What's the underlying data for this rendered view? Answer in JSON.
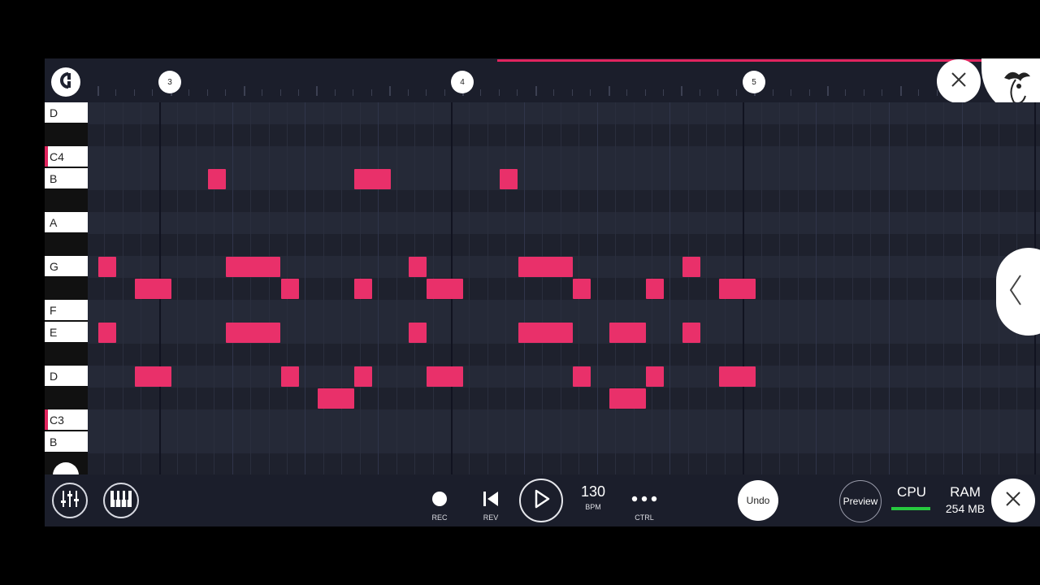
{
  "timeline": {
    "bar_markers": [
      "3",
      "4",
      "5"
    ]
  },
  "keyboard": {
    "keys": [
      {
        "label": "D",
        "c": false
      },
      {
        "label": "C4",
        "c": true
      },
      {
        "label": "B",
        "c": false
      },
      {
        "label": "A",
        "c": false
      },
      {
        "label": "G",
        "c": false
      },
      {
        "label": "F",
        "c": false
      },
      {
        "label": "E",
        "c": false
      },
      {
        "label": "D",
        "c": false
      },
      {
        "label": "C3",
        "c": true
      },
      {
        "label": "B",
        "c": false
      }
    ]
  },
  "piano_roll": {
    "note_color": "#e9306a",
    "notes": [
      {
        "row": 3,
        "start": 22,
        "len": 1
      },
      {
        "row": 3,
        "start": 30,
        "len": 2
      },
      {
        "row": 3,
        "start": 38,
        "len": 1
      },
      {
        "row": 7,
        "start": 16,
        "len": 1
      },
      {
        "row": 7,
        "start": 23,
        "len": 3
      },
      {
        "row": 7,
        "start": 33,
        "len": 1
      },
      {
        "row": 7,
        "start": 39,
        "len": 3
      },
      {
        "row": 7,
        "start": 48,
        "len": 1
      },
      {
        "row": 8,
        "start": 18,
        "len": 2
      },
      {
        "row": 8,
        "start": 26,
        "len": 1
      },
      {
        "row": 8,
        "start": 30,
        "len": 1
      },
      {
        "row": 8,
        "start": 34,
        "len": 2
      },
      {
        "row": 8,
        "start": 42,
        "len": 1
      },
      {
        "row": 8,
        "start": 46,
        "len": 1
      },
      {
        "row": 8,
        "start": 50,
        "len": 2
      },
      {
        "row": 10,
        "start": 16,
        "len": 1
      },
      {
        "row": 10,
        "start": 23,
        "len": 3
      },
      {
        "row": 10,
        "start": 33,
        "len": 1
      },
      {
        "row": 10,
        "start": 39,
        "len": 3
      },
      {
        "row": 10,
        "start": 44,
        "len": 2
      },
      {
        "row": 10,
        "start": 48,
        "len": 1
      },
      {
        "row": 12,
        "start": 18,
        "len": 2
      },
      {
        "row": 12,
        "start": 26,
        "len": 1
      },
      {
        "row": 12,
        "start": 30,
        "len": 1
      },
      {
        "row": 12,
        "start": 34,
        "len": 2
      },
      {
        "row": 12,
        "start": 42,
        "len": 1
      },
      {
        "row": 12,
        "start": 46,
        "len": 1
      },
      {
        "row": 12,
        "start": 50,
        "len": 2
      },
      {
        "row": 13,
        "start": 28,
        "len": 2
      },
      {
        "row": 13,
        "start": 44,
        "len": 2
      }
    ]
  },
  "transport": {
    "rec_label": "REC",
    "rev_label": "REV",
    "bpm_value": "130",
    "bpm_label": "BPM",
    "ctrl_label": "CTRL",
    "undo_label": "Undo",
    "preview_label": "Preview"
  },
  "status": {
    "cpu_label": "CPU",
    "ram_label": "RAM",
    "ram_value": "254 MB"
  },
  "colors": {
    "accent": "#e0245e",
    "cpu_ok": "#27c93f",
    "background": "#1f2230"
  },
  "icons": [
    "snap-magnet-icon",
    "close-icon",
    "fl-fruit-logo-icon",
    "chevron-left-icon",
    "mixer-icon",
    "piano-keys-icon",
    "record-icon",
    "skip-back-icon",
    "play-icon",
    "more-dots-icon"
  ]
}
